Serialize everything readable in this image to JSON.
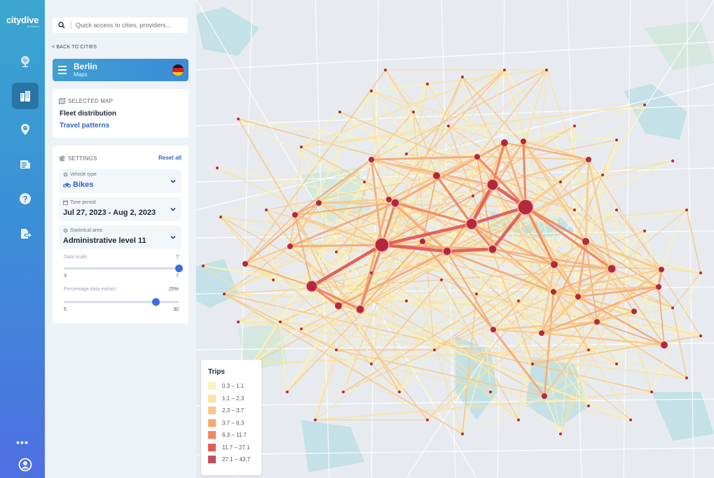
{
  "app": {
    "logo": "citydive",
    "logo_sub": "by fluctuo"
  },
  "rail": {
    "items": [
      {
        "icon": "globe-icon",
        "active": false
      },
      {
        "icon": "buildings-icon",
        "active": true
      },
      {
        "icon": "location-pin-icon",
        "active": false
      },
      {
        "icon": "news-icon",
        "active": false
      },
      {
        "icon": "help-icon",
        "active": false
      },
      {
        "icon": "export-icon",
        "active": false
      }
    ],
    "more": "•••"
  },
  "search": {
    "placeholder": "Quick access to cities, providers..."
  },
  "back_label": "< BACK TO CITIES",
  "city": {
    "name": "Berlin",
    "section": "Maps",
    "flag_colors": [
      "#1a1a1a",
      "#dd1c1c",
      "#ffce00"
    ]
  },
  "maps_card": {
    "header": "SELECTED MAP",
    "selected": "Fleet distribution",
    "other": "Travel patterns"
  },
  "settings": {
    "header": "SETTINGS",
    "reset_label": "Reset all",
    "vehicle": {
      "label": "Vehicle type",
      "value": "Bikes"
    },
    "period": {
      "label": "Time period",
      "value": "Jul 27, 2023 - Aug 2, 2023"
    },
    "area": {
      "label": "Statistical area",
      "value": "Administrative level 11"
    },
    "data_scale": {
      "label": "Data scale",
      "current": "7",
      "min": "3",
      "max": "7",
      "fraction": 1.0
    },
    "extract": {
      "label": "Percentage data extract",
      "current": "25%",
      "min": "5",
      "max": "30",
      "fraction": 0.8
    }
  },
  "legend": {
    "title": "Trips",
    "rows": [
      {
        "label": "0.3 – 1.1",
        "color": "#fbf3b5"
      },
      {
        "label": "1.1 – 2.3",
        "color": "#fbe3a0"
      },
      {
        "label": "2.3 – 3.7",
        "color": "#f9c889"
      },
      {
        "label": "3.7 – 6.3",
        "color": "#f6a873"
      },
      {
        "label": "6.3 – 11.7",
        "color": "#f1865f"
      },
      {
        "label": "11.7 – 27.1",
        "color": "#e35b55"
      },
      {
        "label": "27.1 – 43.7",
        "color": "#c74a5c"
      }
    ]
  },
  "colors": {
    "accent": "#2f64c8",
    "node": "#b3283c"
  }
}
